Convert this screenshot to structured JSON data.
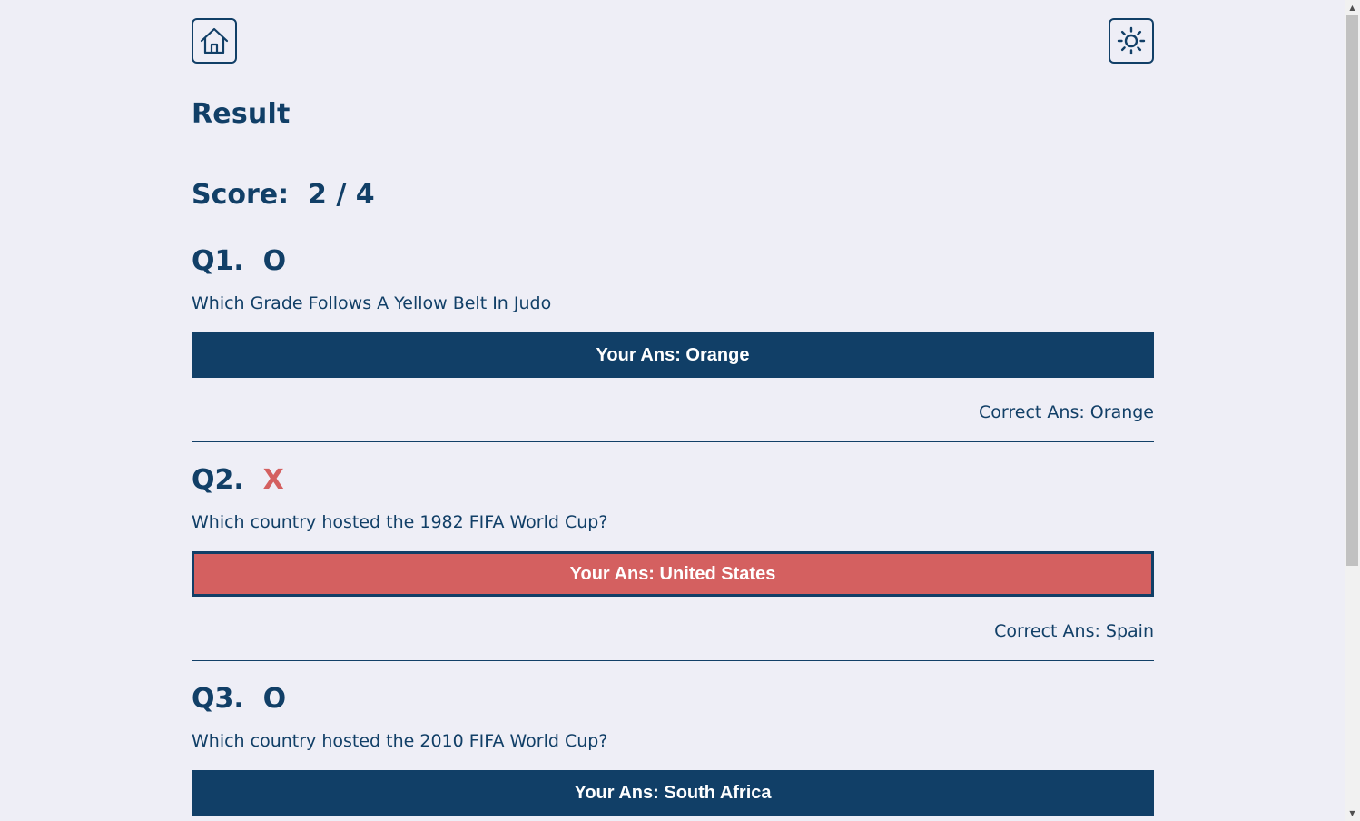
{
  "header": {
    "home_icon": "home-icon",
    "theme_icon": "sun-icon"
  },
  "page": {
    "title": "Result",
    "score_label": "Score:",
    "score_value": "2 / 4"
  },
  "questions": [
    {
      "number": "Q1.",
      "mark": "O",
      "correct": true,
      "text": "Which Grade Follows A Yellow Belt In Judo",
      "your_answer": "Your Ans: Orange",
      "correct_answer": "Correct Ans: Orange"
    },
    {
      "number": "Q2.",
      "mark": "X",
      "correct": false,
      "text": "Which country hosted the 1982 FIFA World Cup?",
      "your_answer": "Your Ans: United States",
      "correct_answer": "Correct Ans: Spain"
    },
    {
      "number": "Q3.",
      "mark": "O",
      "correct": true,
      "text": "Which country hosted the 2010 FIFA World Cup?",
      "your_answer": "Your Ans: South Africa"
    }
  ],
  "colors": {
    "primary": "#113f67",
    "wrong": "#d46060",
    "background": "#eeeef6"
  }
}
